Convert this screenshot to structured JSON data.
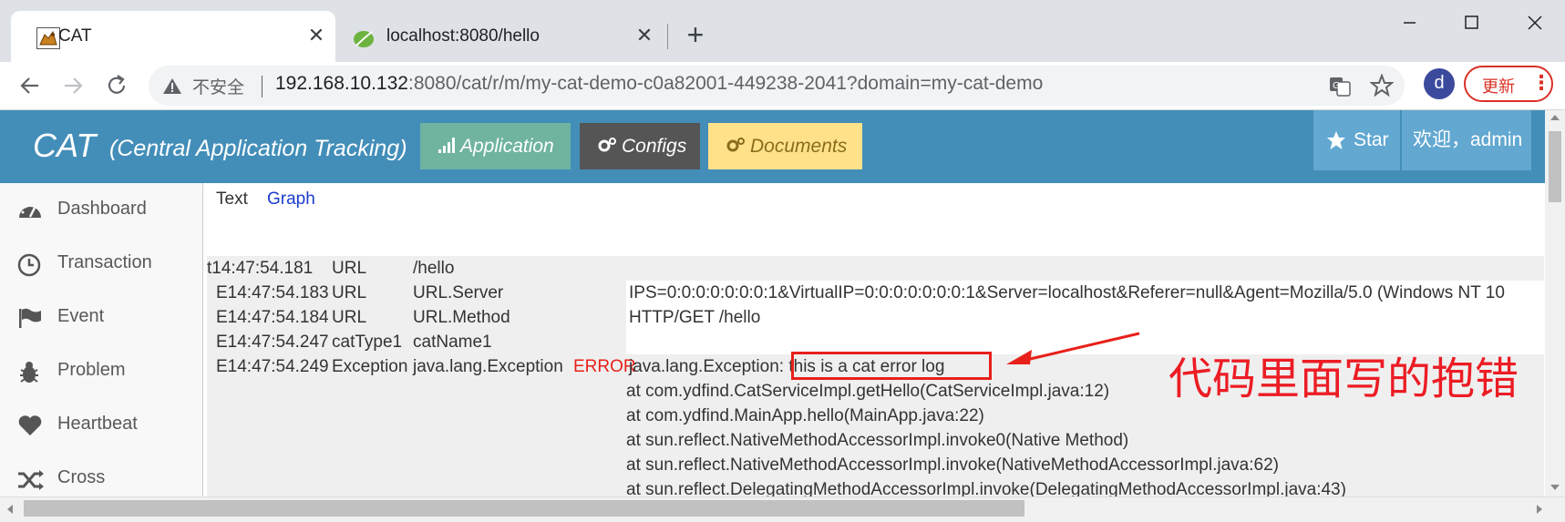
{
  "browser": {
    "tabs": [
      {
        "title": "CAT",
        "icon": "cat-favicon-icon",
        "active": true
      },
      {
        "title": "localhost:8080/hello",
        "icon": "spring-leaf-icon",
        "active": false
      }
    ],
    "new_tab": "+",
    "address": {
      "security_label": "不安全",
      "host": "192.168.10.132",
      "path": ":8080/cat/r/m/my-cat-demo-c0a82001-449238-2041?domain=my-cat-demo"
    },
    "avatar_letter": "d",
    "update_label": "更新",
    "update_menu": "⋮"
  },
  "header": {
    "title": "CAT",
    "subtitle": "(Central Application Tracking)",
    "nav": [
      {
        "label": "Application",
        "icon": "signal-icon"
      },
      {
        "label": "Configs",
        "icon": "cogs-icon"
      },
      {
        "label": "Documents",
        "icon": "cogs-icon"
      }
    ],
    "star_label": "Star",
    "user_label": "欢迎，admin",
    "colors": {
      "header": "#438eb9",
      "application": "#6fb3a0",
      "configs": "#555555",
      "documents": "#fee188"
    }
  },
  "sidebar": {
    "items": [
      {
        "label": "Dashboard",
        "icon": "dashboard-icon"
      },
      {
        "label": "Transaction",
        "icon": "clock-icon"
      },
      {
        "label": "Event",
        "icon": "flag-icon"
      },
      {
        "label": "Problem",
        "icon": "bug-icon"
      },
      {
        "label": "Heartbeat",
        "icon": "heart-icon"
      },
      {
        "label": "Cross",
        "icon": "random-icon"
      }
    ]
  },
  "main": {
    "views": [
      {
        "label": "Text"
      },
      {
        "label": "Graph"
      }
    ],
    "log": [
      {
        "time": "t14:47:54.181",
        "type": "URL",
        "name": "/hello",
        "status": "",
        "data": ""
      },
      {
        "time": "E14:47:54.183",
        "type": "URL",
        "name": "URL.Server",
        "status": "",
        "data": "IPS=0:0:0:0:0:0:0:1&VirtualIP=0:0:0:0:0:0:0:1&Server=localhost&Referer=null&Agent=Mozilla/5.0 (Windows NT 10"
      },
      {
        "time": "E14:47:54.184",
        "type": "URL",
        "name": "URL.Method",
        "status": "",
        "data": "HTTP/GET /hello"
      },
      {
        "time": "E14:47:54.247",
        "type": "catType1",
        "name": "catName1",
        "status": "",
        "data": ""
      },
      {
        "time": "E14:47:54.249",
        "type": "Exception",
        "name": "java.lang.Exception",
        "status": "ERROR",
        "data_prefix": "java.lang.Exception: ",
        "data_highlight": "this is a cat error log"
      }
    ],
    "stack_trace": [
      "at com.ydfind.CatServiceImpl.getHello(CatServiceImpl.java:12)",
      "at com.ydfind.MainApp.hello(MainApp.java:22)",
      "at sun.reflect.NativeMethodAccessorImpl.invoke0(Native Method)",
      "at sun.reflect.NativeMethodAccessorImpl.invoke(NativeMethodAccessorImpl.java:62)",
      "at sun.reflect.DelegatingMethodAccessorImpl.invoke(DelegatingMethodAccessorImpl.java:43)"
    ]
  },
  "annotation": {
    "text": "代码里面写的抱错",
    "color": "#ec1c24"
  }
}
